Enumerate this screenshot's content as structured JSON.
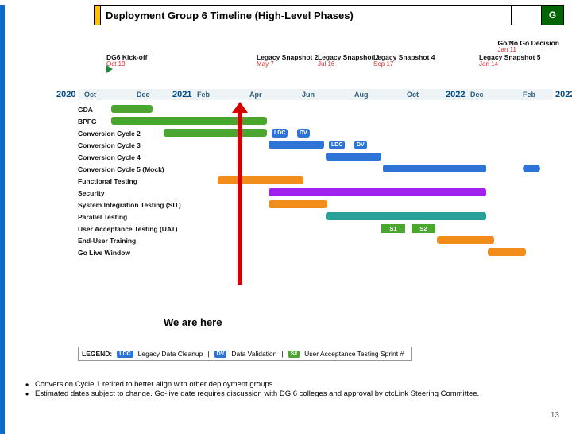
{
  "title": "Deployment Group 6 Timeline (High-Level Phases)",
  "status_badge": "G",
  "go_no_go": {
    "label": "Go/No Go Decision",
    "date": "Jan 11"
  },
  "years": {
    "left_start": "2020",
    "mid": "2021",
    "right_a": "2022",
    "right_b": "2022"
  },
  "months": [
    "Oct",
    "Dec",
    "Feb",
    "Apr",
    "Jun",
    "Aug",
    "Oct",
    "Dec",
    "Feb"
  ],
  "events": [
    {
      "label": "DG6 Kick-off",
      "date": "Oct 19"
    },
    {
      "label": "Legacy Snapshot 2",
      "date": "May 7"
    },
    {
      "label": "Legacy Snapshot 3",
      "date": "Jul 16"
    },
    {
      "label": "Legacy Snapshot 4",
      "date": "Sep 17"
    },
    {
      "label": "Legacy Snapshot 5",
      "date": "Jan 14"
    }
  ],
  "rows": [
    "GDA",
    "BPFG",
    "Conversion Cycle 2",
    "Conversion Cycle 3",
    "Conversion Cycle 4",
    "Conversion Cycle 5 (Mock)",
    "Functional Testing",
    "Security",
    "System Integration Testing (SIT)",
    "Parallel Testing",
    "User Acceptance Testing (UAT)",
    "End-User Training",
    "Go Live Window"
  ],
  "pills": {
    "ldc": "LDC",
    "dv": "DV",
    "s1": "S1",
    "s2": "S2"
  },
  "we_are_here": "We are here",
  "legend": {
    "key": "LEGEND:",
    "ldc": "LDC",
    "ldc_text": "Legacy Data Cleanup",
    "dv": "DV",
    "dv_text": "Data Validation",
    "s": "S#",
    "s_text": "User Acceptance Testing Sprint #"
  },
  "footnotes": [
    "Conversion Cycle 1 retired to better align with other deployment groups.",
    "Estimated dates subject to change. Go-live date requires discussion with DG 6 colleges and approval by ctcLink Steering Committee."
  ],
  "page_number": "13",
  "chart_data": {
    "type": "gantt",
    "title": "Deployment Group 6 Timeline (High-Level Phases)",
    "x_axis": {
      "start": "2020-10",
      "end": "2022-03",
      "tick_months": [
        "Oct 2020",
        "Dec 2020",
        "Feb 2021",
        "Apr 2021",
        "Jun 2021",
        "Aug 2021",
        "Oct 2021",
        "Dec 2021",
        "Feb 2022"
      ]
    },
    "milestones": [
      {
        "name": "DG6 Kick-off",
        "date": "2020-10-19"
      },
      {
        "name": "Legacy Snapshot 2",
        "date": "2021-05-07"
      },
      {
        "name": "Legacy Snapshot 3",
        "date": "2021-07-16"
      },
      {
        "name": "Legacy Snapshot 4",
        "date": "2021-09-17"
      },
      {
        "name": "Go/No Go Decision",
        "date": "2022-01-11"
      },
      {
        "name": "Legacy Snapshot 5",
        "date": "2022-01-14"
      }
    ],
    "current_date_marker": "2021-02",
    "series": [
      {
        "name": "GDA",
        "start": "2020-11",
        "end": "2020-12",
        "color": "green"
      },
      {
        "name": "BPFG",
        "start": "2020-11",
        "end": "2021-05",
        "color": "green"
      },
      {
        "name": "Conversion Cycle 2",
        "start": "2021-01",
        "end": "2021-05",
        "color": "green",
        "annotations": [
          {
            "label": "LDC",
            "at": "2021-05"
          },
          {
            "label": "DV",
            "at": "2021-06"
          }
        ]
      },
      {
        "name": "Conversion Cycle 3",
        "start": "2021-05",
        "end": "2021-07",
        "color": "blue",
        "annotations": [
          {
            "label": "LDC",
            "at": "2021-07"
          },
          {
            "label": "DV",
            "at": "2021-08"
          }
        ]
      },
      {
        "name": "Conversion Cycle 4",
        "start": "2021-07",
        "end": "2021-09",
        "color": "blue"
      },
      {
        "name": "Conversion Cycle 5 (Mock)",
        "start": "2021-09",
        "end": "2022-01",
        "color": "blue",
        "extras": [
          {
            "start": "2022-02",
            "end": "2022-02"
          }
        ]
      },
      {
        "name": "Functional Testing",
        "start": "2021-03",
        "end": "2021-06",
        "color": "orange"
      },
      {
        "name": "Security",
        "start": "2021-05",
        "end": "2022-01",
        "color": "purple"
      },
      {
        "name": "System Integration Testing (SIT)",
        "start": "2021-05",
        "end": "2021-07",
        "color": "orange"
      },
      {
        "name": "Parallel Testing",
        "start": "2021-07",
        "end": "2022-01",
        "color": "teal"
      },
      {
        "name": "User Acceptance Testing (UAT)",
        "sprints": [
          {
            "label": "S1",
            "start": "2021-09",
            "end": "2021-10"
          },
          {
            "label": "S2",
            "start": "2021-10",
            "end": "2021-11"
          }
        ]
      },
      {
        "name": "End-User Training",
        "start": "2021-11",
        "end": "2022-01",
        "color": "orange"
      },
      {
        "name": "Go Live Window",
        "start": "2022-01",
        "end": "2022-02",
        "color": "orange"
      }
    ]
  }
}
